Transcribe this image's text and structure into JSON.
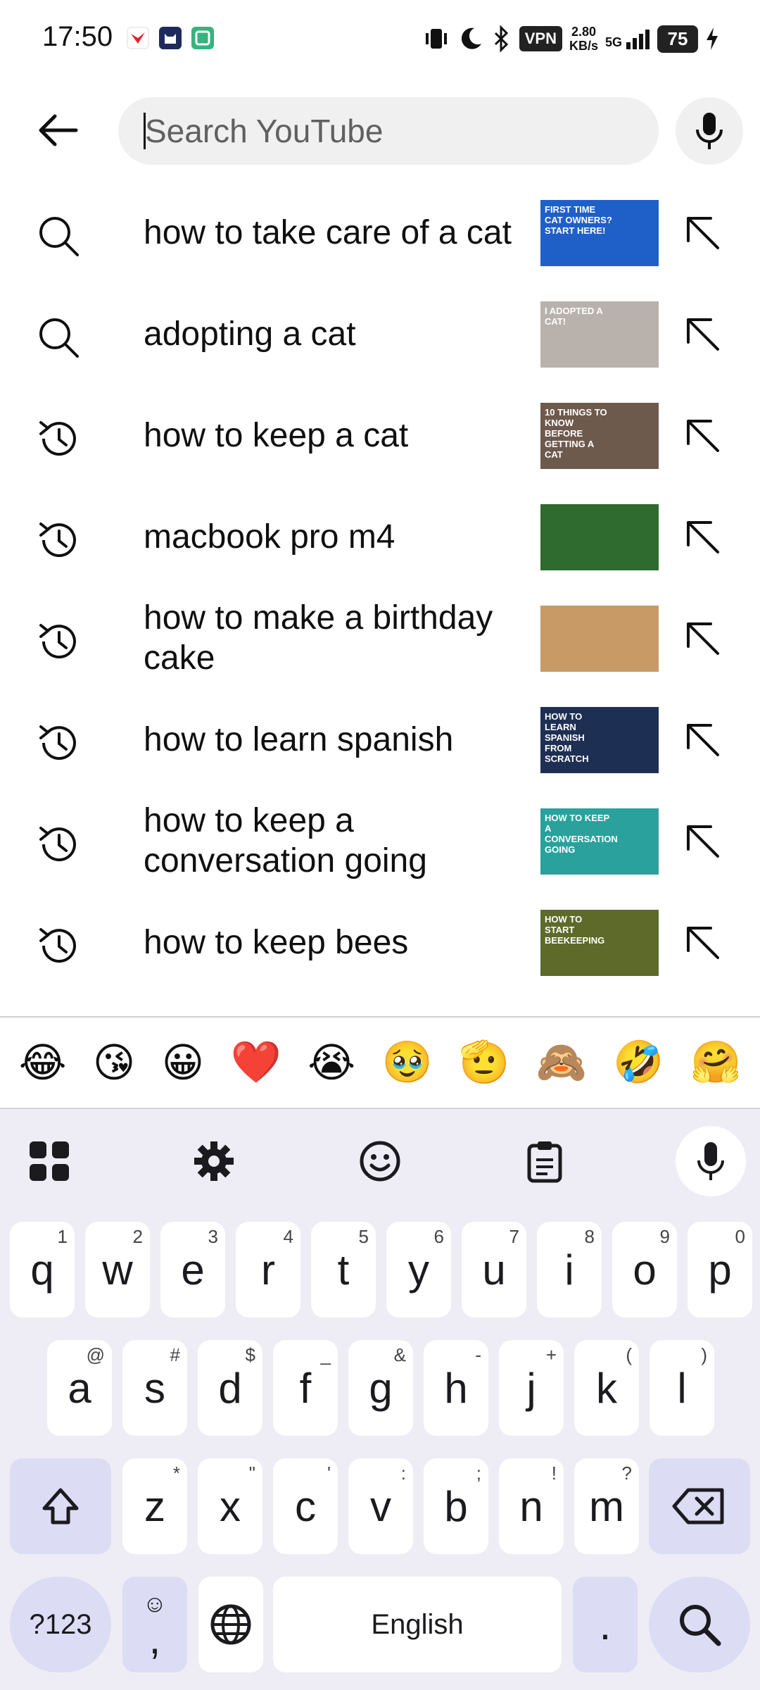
{
  "status_bar": {
    "time": "17:50",
    "vpn": "VPN",
    "speed_value": "2.80",
    "speed_unit": "KB/s",
    "network": "5G",
    "battery": "75"
  },
  "search": {
    "placeholder": "Search YouTube",
    "value": ""
  },
  "suggestions": [
    {
      "type": "search",
      "text": "how to take care of a cat",
      "thumb_text": "FIRST TIME CAT OWNERS? START HERE!",
      "thumb_color": "#1f5fc8"
    },
    {
      "type": "search",
      "text": "adopting a cat",
      "thumb_text": "I adopted a cat!",
      "thumb_color": "#b9b2ac"
    },
    {
      "type": "history",
      "text": "how to keep a cat",
      "thumb_text": "10 THINGS TO KNOW BEFORE GETTING A CAT",
      "thumb_color": "#6e5a4d"
    },
    {
      "type": "history",
      "text": "macbook pro m4",
      "thumb_text": "",
      "thumb_color": "#2f6a2e"
    },
    {
      "type": "history",
      "text": "how to make a birthday cake",
      "thumb_text": "",
      "thumb_color": "#c79a66"
    },
    {
      "type": "history",
      "text": "how to learn spanish",
      "thumb_text": "HOW TO LEARN SPANISH FROM SCRATCH",
      "thumb_color": "#1e2f54"
    },
    {
      "type": "history",
      "text": "how to keep a conversation going",
      "thumb_text": "HOW TO KEEP A CONVERSATION GOING",
      "thumb_color": "#2aa19c"
    },
    {
      "type": "history",
      "text": "how to keep bees",
      "thumb_text": "How To Start Beekeeping",
      "thumb_color": "#5d6a2a"
    }
  ],
  "emojis": [
    "😂",
    "😘",
    "😀",
    "❤️",
    "😭",
    "🥹",
    "🫡",
    "🙈",
    "🤣",
    "🤗"
  ],
  "keyboard": {
    "row1": [
      {
        "k": "q",
        "h": "1"
      },
      {
        "k": "w",
        "h": "2"
      },
      {
        "k": "e",
        "h": "3"
      },
      {
        "k": "r",
        "h": "4"
      },
      {
        "k": "t",
        "h": "5"
      },
      {
        "k": "y",
        "h": "6"
      },
      {
        "k": "u",
        "h": "7"
      },
      {
        "k": "i",
        "h": "8"
      },
      {
        "k": "o",
        "h": "9"
      },
      {
        "k": "p",
        "h": "0"
      }
    ],
    "row2": [
      {
        "k": "a",
        "h": "@"
      },
      {
        "k": "s",
        "h": "#"
      },
      {
        "k": "d",
        "h": "$"
      },
      {
        "k": "f",
        "h": "_"
      },
      {
        "k": "g",
        "h": "&"
      },
      {
        "k": "h",
        "h": "-"
      },
      {
        "k": "j",
        "h": "+"
      },
      {
        "k": "k",
        "h": "("
      },
      {
        "k": "l",
        "h": ")"
      }
    ],
    "row3": [
      {
        "k": "z",
        "h": "*"
      },
      {
        "k": "x",
        "h": "\""
      },
      {
        "k": "c",
        "h": "'"
      },
      {
        "k": "v",
        "h": ":"
      },
      {
        "k": "b",
        "h": ";"
      },
      {
        "k": "n",
        "h": "!"
      },
      {
        "k": "m",
        "h": "?"
      }
    ],
    "symbols_label": "?123",
    "comma_label": ",",
    "space_label": "English",
    "period_label": "."
  }
}
